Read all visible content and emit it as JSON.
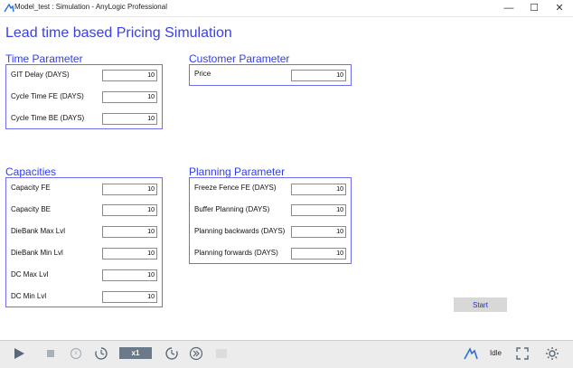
{
  "window": {
    "title": "Model_test : Simulation - AnyLogic Professional",
    "minimize_glyph": "—",
    "maximize_glyph": "☐",
    "close_glyph": "✕"
  },
  "page": {
    "title": "Lead time based Pricing Simulation"
  },
  "time_parameter": {
    "title": "Time Parameter",
    "fields": [
      {
        "label": "GIT Delay (DAYS)",
        "value": "10"
      },
      {
        "label": "Cycle Time FE (DAYS)",
        "value": "10"
      },
      {
        "label": "Cycle Time BE (DAYS)",
        "value": "10"
      }
    ]
  },
  "customer_parameter": {
    "title": "Customer Parameter",
    "fields": [
      {
        "label": "Price",
        "value": "10"
      }
    ]
  },
  "capacities": {
    "title": "Capacities",
    "fields": [
      {
        "label": "Capacity FE",
        "value": "10"
      },
      {
        "label": "Capacity BE",
        "value": "10"
      },
      {
        "label": "DieBank Max Lvl",
        "value": "10"
      },
      {
        "label": "DieBank Min Lvl",
        "value": "10"
      },
      {
        "label": "DC Max Lvl",
        "value": "10"
      },
      {
        "label": "DC Min Lvl",
        "value": "10"
      }
    ]
  },
  "planning_parameter": {
    "title": "Planning Parameter",
    "fields": [
      {
        "label": "Freeze Fence FE (DAYS)",
        "value": "10"
      },
      {
        "label": "Buffer Planning (DAYS)",
        "value": "10"
      },
      {
        "label": "Planning backwards (DAYS)",
        "value": "10"
      },
      {
        "label": "Planning forwards (DAYS)",
        "value": "10"
      }
    ]
  },
  "start_button": {
    "label": "Start"
  },
  "toolbar": {
    "speed": "x1",
    "slower_label": "x",
    "status": "Idle"
  },
  "colors": {
    "title_blue": "#3b41e3",
    "group_border": "#6e6ef2",
    "speed_badge": "#6b7a89"
  },
  "icons": [
    "anylogic-icon",
    "run-icon",
    "stop-icon",
    "slower-icon",
    "realtime-icon",
    "faster-icon",
    "step-icon",
    "developer-panel-icon",
    "fullscreen-icon",
    "settings-icon"
  ]
}
